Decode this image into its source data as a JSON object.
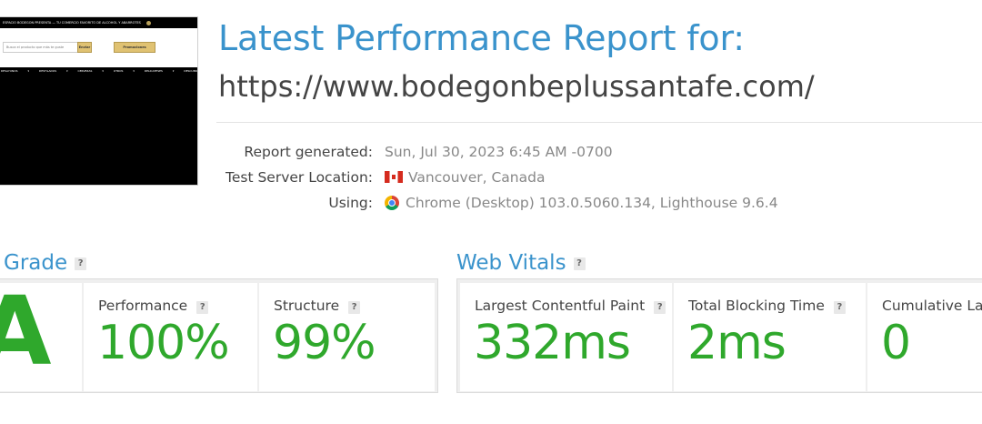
{
  "thumbnail": {
    "top_text": "ESPACIO BODEGON PRESENTA — TU COMERCIO FAVORITO DE ALCOHOL Y ABARROTES",
    "search_placeholder": "Busca el producto que más te guste",
    "search_button": "Enviar",
    "promo_button": "Promociones",
    "nav_text": "DESAYUNOS ▾ DESTILADOS ▾ CERVEZAS ▾ OTROS ▾ DELICATESES ▾ DESCUBRE ▾"
  },
  "header": {
    "title": "Latest Performance Report for:",
    "url": "https://www.bodegonbeplussantafe.com/"
  },
  "meta": {
    "report_label": "Report generated:",
    "report_value": "Sun, Jul 30, 2023 6:45 AM -0700",
    "location_label": "Test Server Location:",
    "location_value": "Vancouver, Canada",
    "using_label": "Using:",
    "using_value": "Chrome (Desktop) 103.0.5060.134, Lighthouse 9.6.4"
  },
  "grade_section": {
    "title": "Grade",
    "help": "?",
    "grade": "A",
    "performance_label": "Performance",
    "performance_value": "100%",
    "structure_label": "Structure",
    "structure_value": "99%"
  },
  "vitals_section": {
    "title": "Web Vitals",
    "help": "?",
    "lcp_label": "Largest Contentful Paint",
    "lcp_value": "332ms",
    "tbt_label": "Total Blocking Time",
    "tbt_value": "2ms",
    "cls_label": "Cumulative Layout Shift",
    "cls_value": "0"
  },
  "colors": {
    "accent": "#3a93cc",
    "good": "#2fa82c"
  }
}
